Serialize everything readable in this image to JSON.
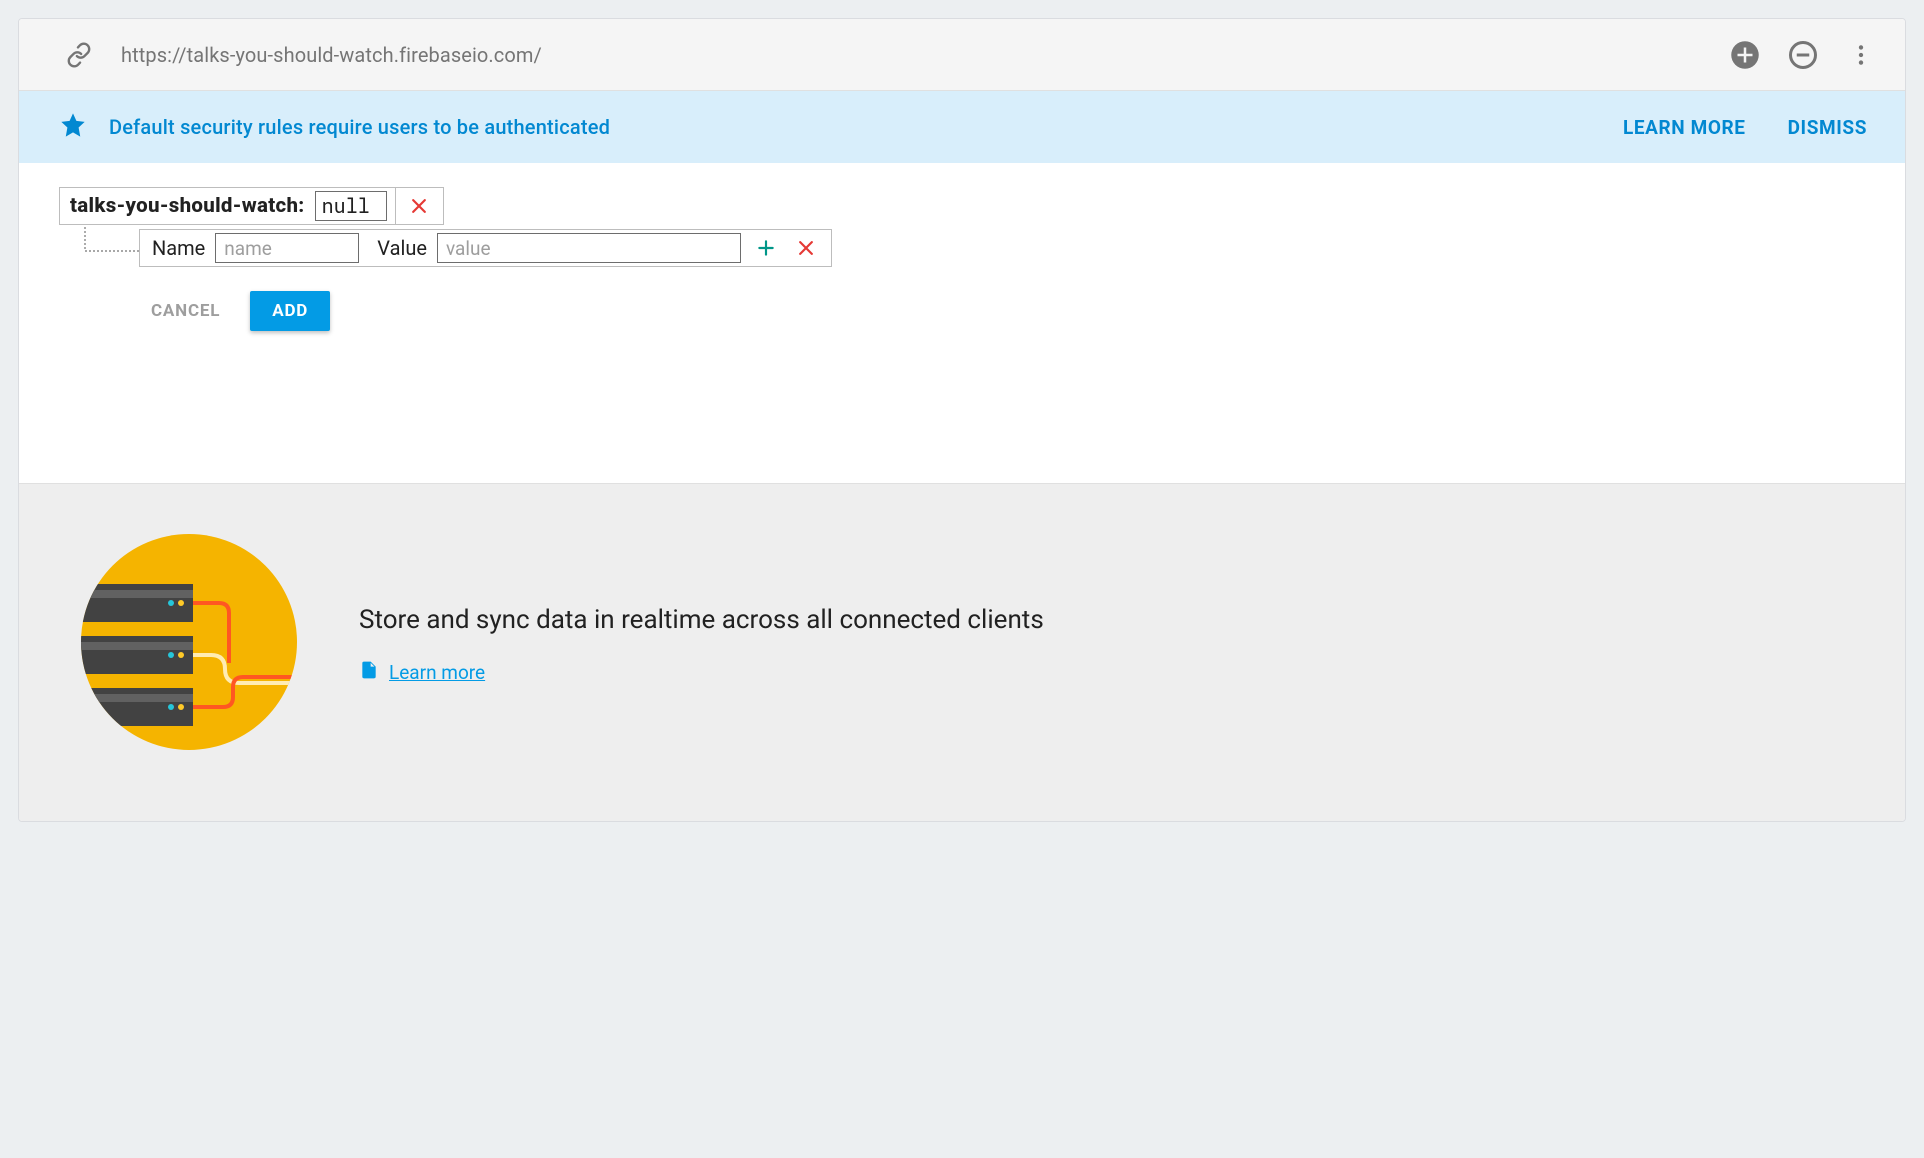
{
  "header": {
    "url": "https://talks-you-should-watch.firebaseio.com/"
  },
  "banner": {
    "message": "Default security rules require users to be authenticated",
    "learn_more": "LEARN MORE",
    "dismiss": "DISMISS"
  },
  "editor": {
    "root_key": "talks-you-should-watch",
    "root_value": "null",
    "child": {
      "name_label": "Name",
      "name_placeholder": "name",
      "name_value": "",
      "value_label": "Value",
      "value_placeholder": "value",
      "value_value": ""
    },
    "cancel_label": "CANCEL",
    "add_label": "ADD"
  },
  "promo": {
    "title": "Store and sync data in realtime across all connected clients",
    "link_text": "Learn more"
  }
}
